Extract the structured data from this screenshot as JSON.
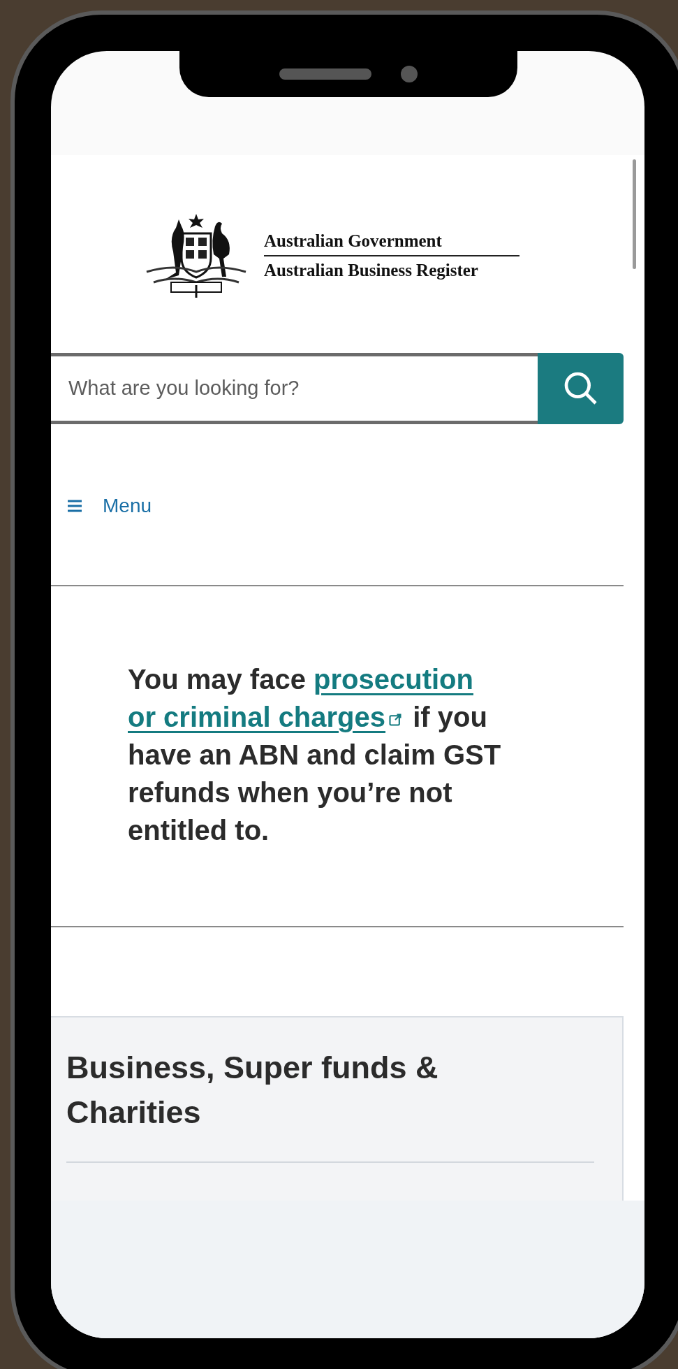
{
  "header": {
    "logo_line_1": "Australian Government",
    "logo_line_2": "Australian Business Register"
  },
  "search": {
    "placeholder": "What are you looking for?"
  },
  "menu": {
    "label": "Menu"
  },
  "notice": {
    "before": "You may face ",
    "link": [
      "prosecution",
      "or criminal charges"
    ],
    "after": " if you have an ABN and claim GST refunds when you’re not entitled to."
  },
  "card": {
    "title": "Business, Super funds & Charities"
  }
}
